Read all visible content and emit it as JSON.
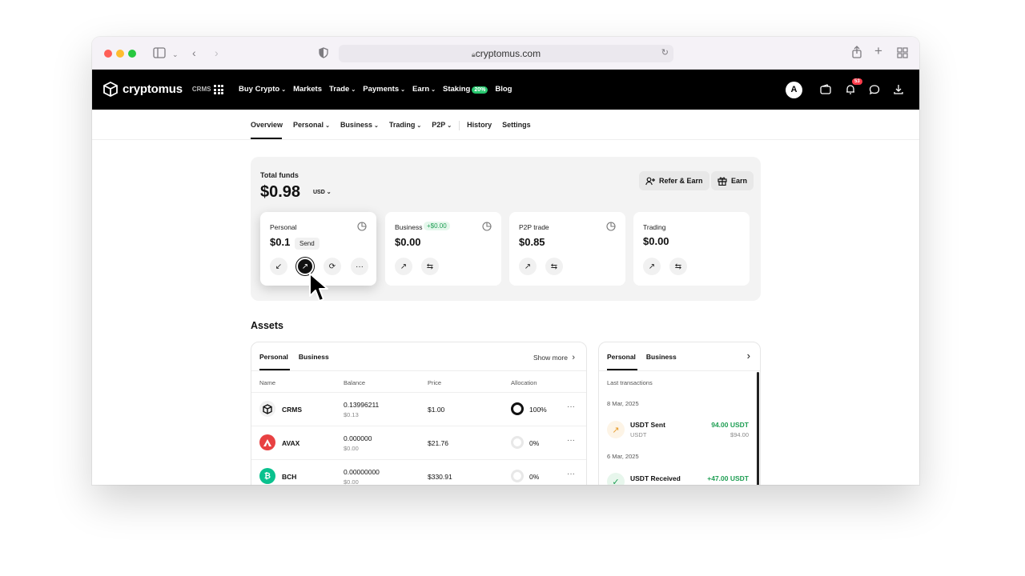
{
  "browser": {
    "url": "cryptomus.com"
  },
  "topnav": {
    "brand": "cryptomus",
    "brand_tag": "CRMS",
    "links": [
      {
        "label": "Buy Crypto",
        "has_menu": true
      },
      {
        "label": "Markets",
        "has_menu": false
      },
      {
        "label": "Trade",
        "has_menu": true
      },
      {
        "label": "Payments",
        "has_menu": true
      },
      {
        "label": "Earn",
        "has_menu": true
      },
      {
        "label": "Staking",
        "has_menu": false,
        "badge": "20%"
      },
      {
        "label": "Blog",
        "has_menu": false
      }
    ],
    "avatar_letter": "A",
    "notification_count": "53"
  },
  "subnav": {
    "items": [
      "Overview",
      "Personal",
      "Business",
      "Trading",
      "P2P",
      "History",
      "Settings"
    ],
    "active": "Overview"
  },
  "funds": {
    "label": "Total funds",
    "value": "$0.98",
    "currency": "USD",
    "refer_label": "Refer & Earn",
    "earn_label": "Earn",
    "cards": [
      {
        "label": "Personal",
        "value": "$0.1",
        "delta": ""
      },
      {
        "label": "Business",
        "value": "$0.00",
        "delta": "+$0.00"
      },
      {
        "label": "P2P trade",
        "value": "$0.85",
        "delta": ""
      },
      {
        "label": "Trading",
        "value": "$0.00",
        "delta": ""
      }
    ],
    "tooltip": "Send"
  },
  "assets": {
    "title": "Assets",
    "tabs": [
      "Personal",
      "Business"
    ],
    "show_more": "Show more",
    "columns": [
      "Name",
      "Balance",
      "Price",
      "Allocation"
    ],
    "rows": [
      {
        "name": "CRMS",
        "balance": "0.13996211",
        "balance_usd": "$0.13",
        "price": "$1.00",
        "allocation": "100%",
        "allocation_fraction": 1.0,
        "color": "#f0f0f0"
      },
      {
        "name": "AVAX",
        "balance": "0.000000",
        "balance_usd": "$0.00",
        "price": "$21.76",
        "allocation": "0%",
        "allocation_fraction": 0.0,
        "color": "#e84142"
      },
      {
        "name": "BCH",
        "balance": "0.00000000",
        "balance_usd": "$0.00",
        "price": "$330.91",
        "allocation": "0%",
        "allocation_fraction": 0.0,
        "color": "#0ac18e"
      }
    ]
  },
  "transactions": {
    "tabs": [
      "Personal",
      "Business"
    ],
    "heading": "Last transactions",
    "groups": [
      {
        "date": "8 Mar, 2025",
        "title": "USDT Sent",
        "sub": "USDT",
        "amount": "94.00 USDT",
        "amount_usd": "$94.00"
      },
      {
        "date": "6 Mar, 2025",
        "title": "USDT Received",
        "sub": "",
        "amount": "+47.00 USDT",
        "amount_usd": ""
      }
    ]
  }
}
